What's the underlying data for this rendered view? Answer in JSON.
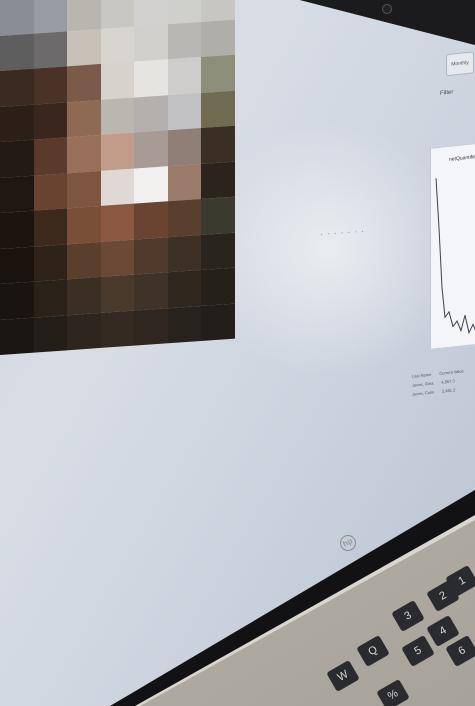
{
  "screen": {
    "faint_text": "· · · · · · ·"
  },
  "video_tile": {
    "pixel_colors": [
      "#8a8d94",
      "#9a9ca3",
      "#b9b6b0",
      "#c9c7c2",
      "#d3d1cf",
      "#cfcfcc",
      "#c8c6c2",
      "#5f5e5f",
      "#6c6a6a",
      "#c8c1b8",
      "#d8d4cf",
      "#d2d0cd",
      "#b9b7b4",
      "#b0aea9",
      "#3a2a22",
      "#4a3226",
      "#7a5a48",
      "#d8d2cc",
      "#e6e4e1",
      "#cfcdcb",
      "#8d8f7a",
      "#2c1f18",
      "#3a261c",
      "#8e6a55",
      "#bcb6b0",
      "#b3b0ad",
      "#c2c2c4",
      "#6f6c52",
      "#241a14",
      "#5a3a2a",
      "#9b705a",
      "#c29c88",
      "#a89a94",
      "#8f7f76",
      "#3b2e22",
      "#1f1710",
      "#6a4230",
      "#7d5540",
      "#e0d8d4",
      "#f2f0ef",
      "#9b7c6a",
      "#2c241c",
      "#1c140e",
      "#3d281c",
      "#7a4f38",
      "#8a5840",
      "#6a4331",
      "#5a3e2e",
      "#3a3a2e",
      "#1a130d",
      "#2e2219",
      "#5a3f2d",
      "#6a4a36",
      "#4f3a2c",
      "#3d3024",
      "#2a241e",
      "#191410",
      "#2a2219",
      "#3b2e23",
      "#4a3a2c",
      "#3f3226",
      "#2f261e",
      "#26201a",
      "#1a1612",
      "#241e18",
      "#2e261e",
      "#342a22",
      "#2e261f",
      "#28221c",
      "#231e19"
    ]
  },
  "panel": {
    "tab_label": "Monthly",
    "filter_label": "Filter",
    "card_title": "netQuantified",
    "table_rows": [
      [
        "Last Name",
        "Current Value",
        "F"
      ],
      [
        "Jones, Gina",
        "4,567.3",
        ""
      ],
      [
        "Jones, Colin",
        "2,451.2",
        ""
      ]
    ]
  },
  "laptop": {
    "logo_text": "hp",
    "keys": [
      "1",
      "2",
      "3",
      "4",
      "5",
      "6",
      "Q",
      "W",
      "%"
    ]
  }
}
